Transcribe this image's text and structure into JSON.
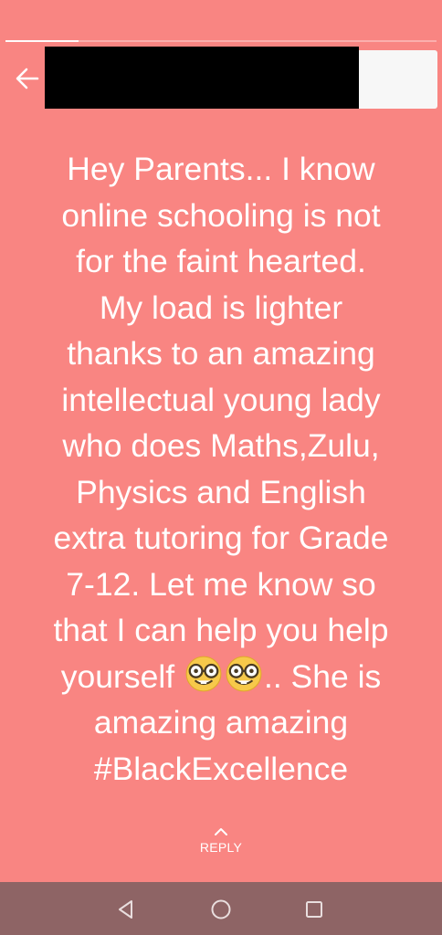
{
  "theme": {
    "background": "#f98582",
    "text": "#ffffff",
    "navbar": "#8e6465"
  },
  "progress": {
    "segments": 1,
    "current_fraction": 0.17
  },
  "header": {
    "back_icon": "arrow-left-icon"
  },
  "status": {
    "lines": [
      "Hey Parents... I know",
      "online schooling is not",
      "for the faint hearted.",
      "My load is lighter",
      "thanks to an amazing",
      "intellectual young lady",
      "who does Maths,Zulu,",
      "Physics and English",
      "extra tutoring for Grade",
      "7-12. Let me know so",
      "that I can help you help"
    ],
    "line_with_emoji_prefix": "yourself",
    "line_with_emoji_suffix": ".. She is",
    "emoji": [
      "nerd-face-emoji",
      "nerd-face-emoji"
    ],
    "lines_after": [
      "amazing amazing",
      "#BlackExcellence"
    ]
  },
  "reply": {
    "label": "REPLY",
    "icon": "chevron-up-icon"
  },
  "navbar": {
    "back_icon": "nav-back-triangle-icon",
    "home_icon": "nav-home-circle-icon",
    "recents_icon": "nav-recents-square-icon"
  }
}
